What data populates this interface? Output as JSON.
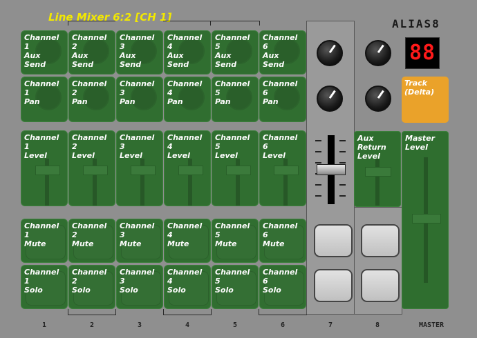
{
  "title": "Line Mixer 6:2  [CH 1]",
  "logo": "ALIAS8",
  "display": {
    "value": "88",
    "color": "#ff1a1a"
  },
  "track_button": {
    "label": "Track\n(Delta)",
    "color": "#eaa22a"
  },
  "channels": [
    {
      "aux_send": "Channel\n1\nAux\nSend",
      "pan": "Channel\n1\nPan",
      "level": "Channel\n1\nLevel",
      "mute": "Channel\n1\nMute",
      "solo": "Channel\n1\nSolo"
    },
    {
      "aux_send": "Channel\n2\nAux\nSend",
      "pan": "Channel\n2\nPan",
      "level": "Channel\n2\nLevel",
      "mute": "Channel\n2\nMute",
      "solo": "Channel\n2\nSolo"
    },
    {
      "aux_send": "Channel\n3\nAux\nSend",
      "pan": "Channel\n3\nPan",
      "level": "Channel\n3\nLevel",
      "mute": "Channel\n3\nMute",
      "solo": "Channel\n3\nSolo"
    },
    {
      "aux_send": "Channel\n4\nAux\nSend",
      "pan": "Channel\n4\nPan",
      "level": "Channel\n4\nLevel",
      "mute": "Channel\n4\nMute",
      "solo": "Channel\n4\nSolo"
    },
    {
      "aux_send": "Channel\n5\nAux\nSend",
      "pan": "Channel\n5\nPan",
      "level": "Channel\n5\nLevel",
      "mute": "Channel\n5\nMute",
      "solo": "Channel\n5\nSolo"
    },
    {
      "aux_send": "Channel\n6\nAux\nSend",
      "pan": "Channel\n6\nPan",
      "level": "Channel\n6\nLevel",
      "mute": "Channel\n6\nMute",
      "solo": "Channel\n6\nSolo"
    }
  ],
  "aux_return": {
    "label": "Aux\nReturn\nLevel"
  },
  "master": {
    "label": "Master\nLevel"
  },
  "column_numbers": [
    "1",
    "2",
    "3",
    "4",
    "5",
    "6",
    "7",
    "8",
    "MASTER"
  ],
  "colors": {
    "overlay_green": "#2f6e2f",
    "title_yellow": "#f2e800",
    "panel_gray": "#8f8f8f"
  }
}
